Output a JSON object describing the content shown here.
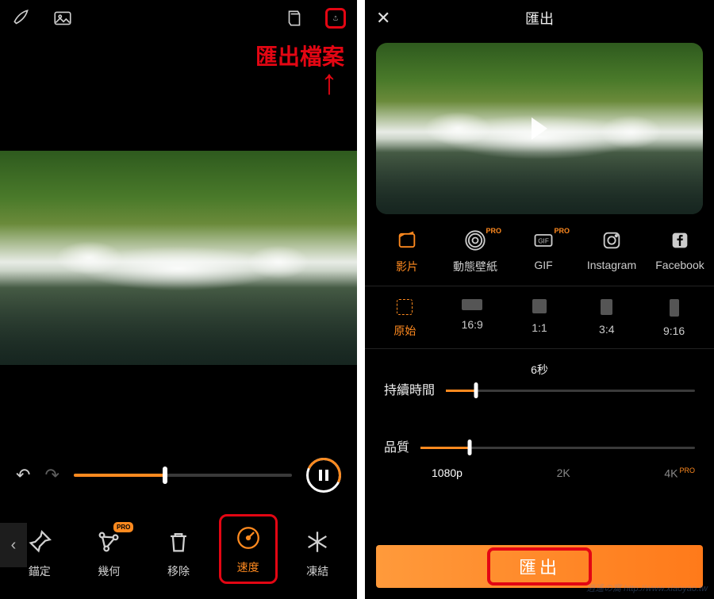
{
  "left": {
    "annotation": "匯出檔案",
    "tools": [
      {
        "key": "anchor",
        "label": "錨定",
        "pro": false,
        "icon": "pin"
      },
      {
        "key": "shape",
        "label": "幾何",
        "pro": true,
        "icon": "shape"
      },
      {
        "key": "remove",
        "label": "移除",
        "pro": false,
        "icon": "trash"
      },
      {
        "key": "speed",
        "label": "速度",
        "pro": false,
        "icon": "speed",
        "active": true,
        "highlight": true
      },
      {
        "key": "freeze",
        "label": "凍結",
        "pro": false,
        "icon": "snow"
      }
    ],
    "slider_percent": 42
  },
  "right": {
    "title": "匯出",
    "formats": [
      {
        "key": "video",
        "label": "影片",
        "pro": false,
        "active": true
      },
      {
        "key": "livewp",
        "label": "動態壁紙",
        "pro": true
      },
      {
        "key": "gif",
        "label": "GIF",
        "pro": true
      },
      {
        "key": "instagram",
        "label": "Instagram",
        "pro": false
      },
      {
        "key": "facebook",
        "label": "Facebook",
        "pro": false
      }
    ],
    "ratios": [
      {
        "key": "orig",
        "label": "原始",
        "active": true
      },
      {
        "key": "169",
        "label": "16:9"
      },
      {
        "key": "11",
        "label": "1:1"
      },
      {
        "key": "34",
        "label": "3:4"
      },
      {
        "key": "916",
        "label": "9:16"
      }
    ],
    "duration": {
      "label": "持續時間",
      "value_label": "6秒",
      "percent": 12
    },
    "quality": {
      "label": "品質",
      "percent": 18,
      "ticks": [
        "1080p",
        "2K",
        "4K"
      ],
      "pro_on": "4K"
    },
    "export_button": "匯出"
  },
  "colors": {
    "accent": "#ff8a1f",
    "highlight": "#e30613"
  },
  "icons": {
    "brush": "brush-icon",
    "image": "image-icon",
    "layers": "layers-icon",
    "export": "export-icon",
    "close": "close-icon",
    "undo": "undo-icon",
    "redo": "redo-icon",
    "pause": "pause-icon",
    "play": "play-icon",
    "chevron": "chevron-left-icon"
  }
}
